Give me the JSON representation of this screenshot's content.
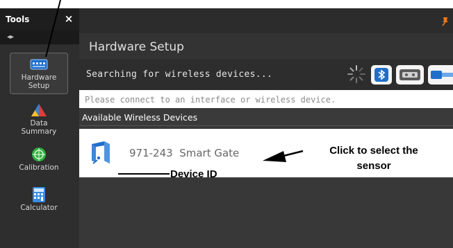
{
  "tools_panel": {
    "title": "Tools",
    "close_glyph": "×",
    "grip_glyph": "◂▸",
    "items": [
      {
        "label": "Hardware\nSetup",
        "icon": "hardware-setup-icon",
        "active": true
      },
      {
        "label": "Data\nSummary",
        "icon": "data-summary-icon",
        "active": false
      },
      {
        "label": "Calibration",
        "icon": "calibration-icon",
        "active": false
      },
      {
        "label": "Calculator",
        "icon": "calculator-icon",
        "active": false
      }
    ]
  },
  "main": {
    "title": "Hardware Setup",
    "search_status": "Searching for wireless devices...",
    "connect_message": "Please connect to an interface or wireless device.",
    "available_header": "Available Wireless Devices",
    "devices": [
      {
        "id": "971-243",
        "name": "Smart Gate",
        "label": "971-243  Smart Gate",
        "icon": "smart-gate-icon"
      }
    ],
    "toolbar_icons": [
      "spinner-icon",
      "bluetooth-icon",
      "usb-interface-icon",
      "cable-icon"
    ],
    "pin_icon": "pin-icon"
  },
  "annotations": {
    "click_to_select": "Click to select the\nsensor",
    "device_id": "Device ID"
  },
  "colors": {
    "panel_dark": "#2e2e2e",
    "panel_bg": "#383838",
    "accent_blue": "#1f6fc9",
    "pin_orange": "#f07a1a"
  }
}
